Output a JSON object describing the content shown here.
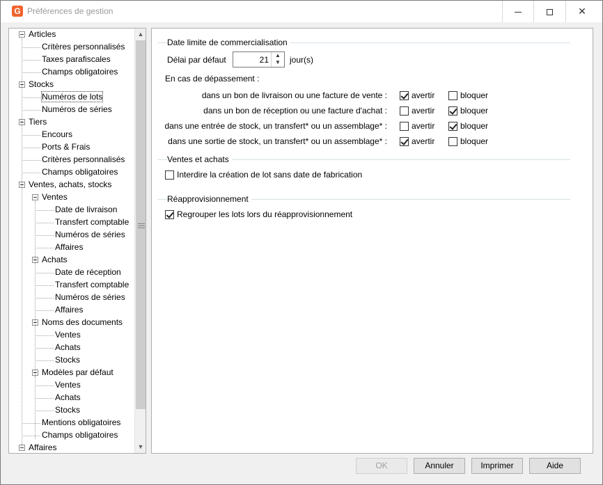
{
  "window": {
    "title": "Préférences de gestion",
    "icon_letter": "G"
  },
  "tree": {
    "items": [
      {
        "label": "Articles",
        "level": 0,
        "expander": true
      },
      {
        "label": "Critères personnalisés",
        "level": 1
      },
      {
        "label": "Taxes parafiscales",
        "level": 1
      },
      {
        "label": "Champs obligatoires",
        "level": 1
      },
      {
        "label": "Stocks",
        "level": 0,
        "expander": true
      },
      {
        "label": "Numéros de lots",
        "level": 1,
        "selected": true
      },
      {
        "label": "Numéros de séries",
        "level": 1
      },
      {
        "label": "Tiers",
        "level": 0,
        "expander": true
      },
      {
        "label": "Encours",
        "level": 1
      },
      {
        "label": "Ports & Frais",
        "level": 1
      },
      {
        "label": "Critères personnalisés",
        "level": 1
      },
      {
        "label": "Champs obligatoires",
        "level": 1
      },
      {
        "label": "Ventes, achats, stocks",
        "level": 0,
        "expander": true
      },
      {
        "label": "Ventes",
        "level": 1,
        "expander": true
      },
      {
        "label": "Date de livraison",
        "level": 2
      },
      {
        "label": "Transfert comptable",
        "level": 2
      },
      {
        "label": "Numéros de séries",
        "level": 2
      },
      {
        "label": "Affaires",
        "level": 2
      },
      {
        "label": "Achats",
        "level": 1,
        "expander": true
      },
      {
        "label": "Date de réception",
        "level": 2
      },
      {
        "label": "Transfert comptable",
        "level": 2
      },
      {
        "label": "Numéros de séries",
        "level": 2
      },
      {
        "label": "Affaires",
        "level": 2
      },
      {
        "label": "Noms des documents",
        "level": 1,
        "expander": true
      },
      {
        "label": "Ventes",
        "level": 2
      },
      {
        "label": "Achats",
        "level": 2
      },
      {
        "label": "Stocks",
        "level": 2
      },
      {
        "label": "Modèles par défaut",
        "level": 1,
        "expander": true
      },
      {
        "label": "Ventes",
        "level": 2
      },
      {
        "label": "Achats",
        "level": 2
      },
      {
        "label": "Stocks",
        "level": 2
      },
      {
        "label": "Mentions obligatoires",
        "level": 1
      },
      {
        "label": "Champs obligatoires",
        "level": 1
      },
      {
        "label": "Affaires",
        "level": 0,
        "expander": true
      }
    ]
  },
  "date_limite": {
    "title": "Date limite de commercialisation",
    "delai_label": "Délai par défaut",
    "delai_value": "21",
    "delai_unit": "jour(s)",
    "depassement_label": "En cas de dépassement :",
    "avertir_label": "avertir",
    "bloquer_label": "bloquer",
    "rows": [
      {
        "label": "dans un bon de livraison ou une facture de vente :",
        "avertir": true,
        "bloquer": false
      },
      {
        "label": "dans un bon de réception ou une facture d'achat :",
        "avertir": false,
        "bloquer": true
      },
      {
        "label": "dans une entrée de stock, un transfert* ou un assemblage* :",
        "avertir": false,
        "bloquer": true
      },
      {
        "label": "dans une sortie de stock, un transfert* ou un assemblage* :",
        "avertir": true,
        "bloquer": false
      }
    ]
  },
  "ventes_achats": {
    "title": "Ventes et achats",
    "option_label": "Interdire la création de lot sans date de fabrication",
    "option_checked": false
  },
  "reappro": {
    "title": "Réapprovisionnement",
    "option_label": "Regrouper les lots lors du réapprovisionnement",
    "option_checked": true
  },
  "buttons": {
    "ok": "OK",
    "annuler": "Annuler",
    "imprimer": "Imprimer",
    "aide": "Aide"
  }
}
